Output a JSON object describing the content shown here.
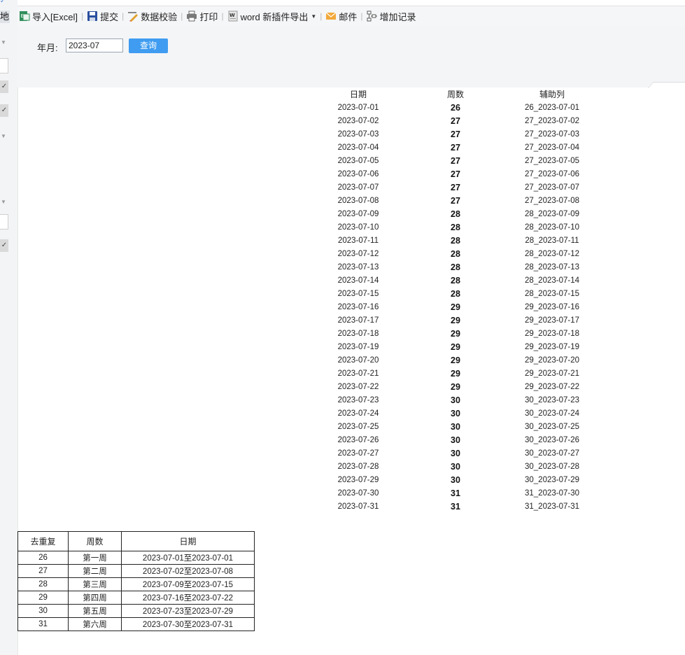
{
  "left_strip": {
    "partial_char": "地"
  },
  "toolbar": {
    "items": [
      {
        "label": "导入[Excel]",
        "icon": "excel-import-icon"
      },
      {
        "label": "提交",
        "icon": "save-icon"
      },
      {
        "label": "数据校验",
        "icon": "data-check-icon"
      },
      {
        "label": "打印",
        "icon": "print-icon"
      },
      {
        "label": "word 新插件导出",
        "icon": "word-icon",
        "has_dropdown": true
      },
      {
        "label": "邮件",
        "icon": "mail-icon"
      },
      {
        "label": "增加记录",
        "icon": "add-record-icon"
      }
    ]
  },
  "query": {
    "label": "年月:",
    "value": "2023-07",
    "button": "查询"
  },
  "daily_table": {
    "headers": [
      "日期",
      "周数",
      "辅助列"
    ],
    "rows": [
      [
        "2023-07-01",
        "26",
        "26_2023-07-01"
      ],
      [
        "2023-07-02",
        "27",
        "27_2023-07-02"
      ],
      [
        "2023-07-03",
        "27",
        "27_2023-07-03"
      ],
      [
        "2023-07-04",
        "27",
        "27_2023-07-04"
      ],
      [
        "2023-07-05",
        "27",
        "27_2023-07-05"
      ],
      [
        "2023-07-06",
        "27",
        "27_2023-07-06"
      ],
      [
        "2023-07-07",
        "27",
        "27_2023-07-07"
      ],
      [
        "2023-07-08",
        "27",
        "27_2023-07-08"
      ],
      [
        "2023-07-09",
        "28",
        "28_2023-07-09"
      ],
      [
        "2023-07-10",
        "28",
        "28_2023-07-10"
      ],
      [
        "2023-07-11",
        "28",
        "28_2023-07-11"
      ],
      [
        "2023-07-12",
        "28",
        "28_2023-07-12"
      ],
      [
        "2023-07-13",
        "28",
        "28_2023-07-13"
      ],
      [
        "2023-07-14",
        "28",
        "28_2023-07-14"
      ],
      [
        "2023-07-15",
        "28",
        "28_2023-07-15"
      ],
      [
        "2023-07-16",
        "29",
        "29_2023-07-16"
      ],
      [
        "2023-07-17",
        "29",
        "29_2023-07-17"
      ],
      [
        "2023-07-18",
        "29",
        "29_2023-07-18"
      ],
      [
        "2023-07-19",
        "29",
        "29_2023-07-19"
      ],
      [
        "2023-07-20",
        "29",
        "29_2023-07-20"
      ],
      [
        "2023-07-21",
        "29",
        "29_2023-07-21"
      ],
      [
        "2023-07-22",
        "29",
        "29_2023-07-22"
      ],
      [
        "2023-07-23",
        "30",
        "30_2023-07-23"
      ],
      [
        "2023-07-24",
        "30",
        "30_2023-07-24"
      ],
      [
        "2023-07-25",
        "30",
        "30_2023-07-25"
      ],
      [
        "2023-07-26",
        "30",
        "30_2023-07-26"
      ],
      [
        "2023-07-27",
        "30",
        "30_2023-07-27"
      ],
      [
        "2023-07-28",
        "30",
        "30_2023-07-28"
      ],
      [
        "2023-07-29",
        "30",
        "30_2023-07-29"
      ],
      [
        "2023-07-30",
        "31",
        "31_2023-07-30"
      ],
      [
        "2023-07-31",
        "31",
        "31_2023-07-31"
      ]
    ]
  },
  "week_table": {
    "headers": [
      "去重复",
      "周数",
      "日期"
    ],
    "rows": [
      [
        "26",
        "第一周",
        "2023-07-01至2023-07-01"
      ],
      [
        "27",
        "第二周",
        "2023-07-02至2023-07-08"
      ],
      [
        "28",
        "第三周",
        "2023-07-09至2023-07-15"
      ],
      [
        "29",
        "第四周",
        "2023-07-16至2023-07-22"
      ],
      [
        "30",
        "第五周",
        "2023-07-23至2023-07-29"
      ],
      [
        "31",
        "第六周",
        "2023-07-30至2023-07-31"
      ]
    ]
  }
}
